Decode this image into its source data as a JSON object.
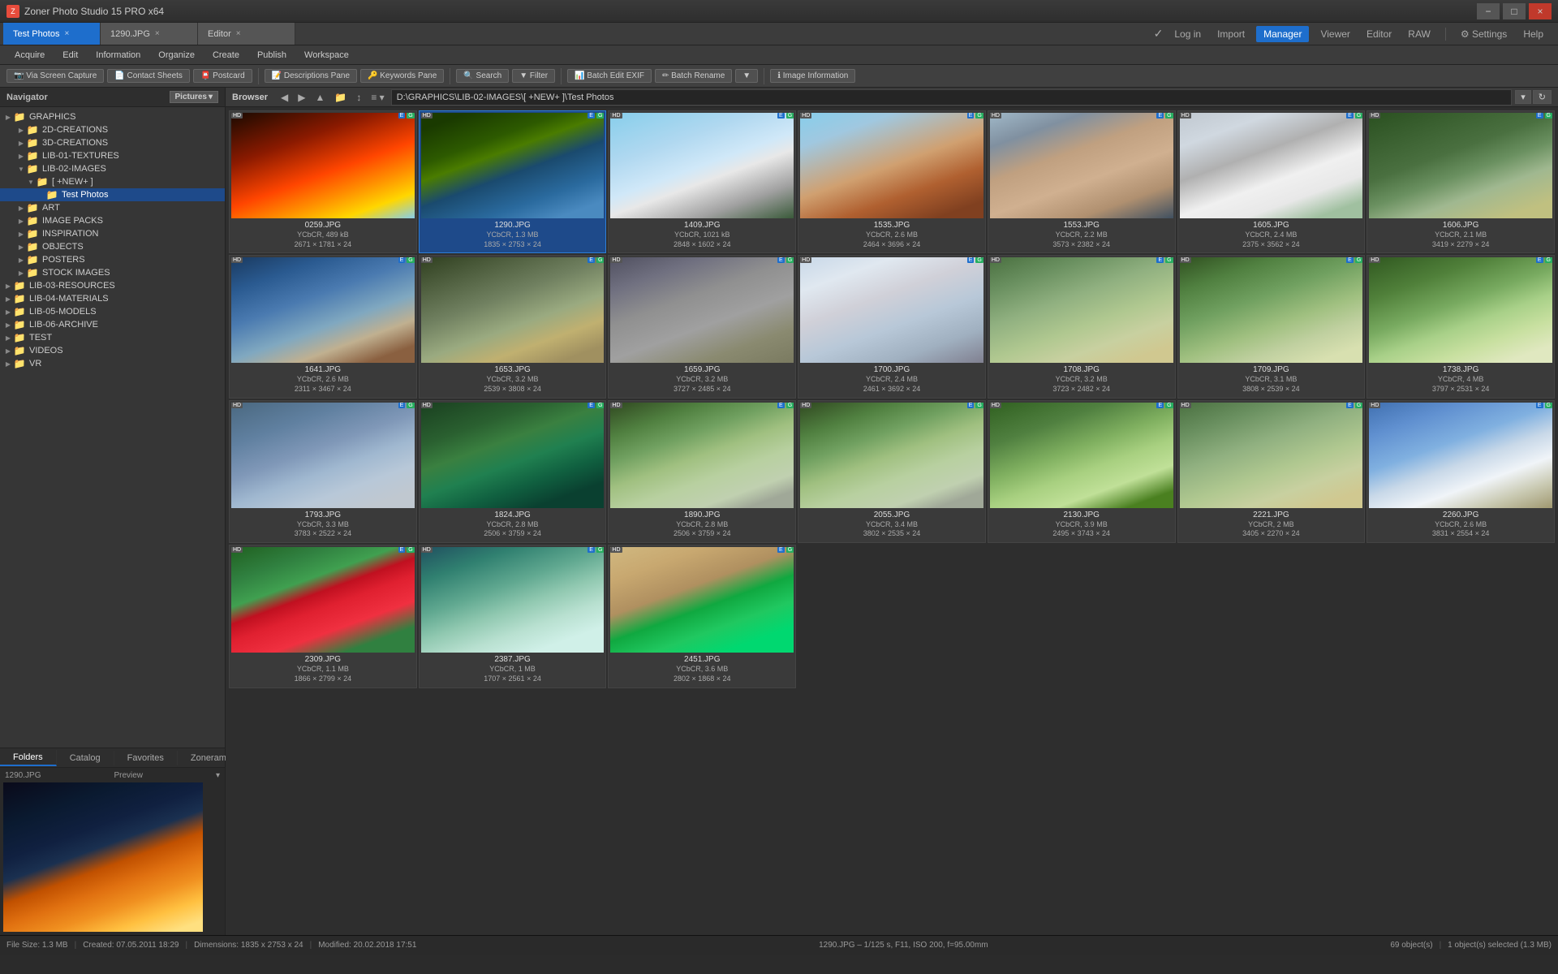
{
  "app": {
    "title": "Zoner Photo Studio 15 PRO x64",
    "icon": "Z"
  },
  "titlebar": {
    "title": "Zoner Photo Studio 15 PRO x64",
    "minimize": "−",
    "maximize": "□",
    "close": "×"
  },
  "tabs": [
    {
      "label": "Test Photos",
      "active": true
    },
    {
      "label": "1290.JPG",
      "active": false
    },
    {
      "label": "Editor",
      "active": false
    }
  ],
  "top_nav": {
    "log_in": "Log in",
    "import": "Import",
    "manager": "Manager",
    "viewer": "Viewer",
    "editor": "Editor",
    "raw": "RAW",
    "settings": "Settings",
    "help": "Help"
  },
  "menu": {
    "items": [
      "Acquire",
      "Edit",
      "Information",
      "Organize",
      "Create",
      "Publish",
      "Workspace"
    ]
  },
  "toolbar": {
    "items": [
      "Via Screen Capture",
      "Contact Sheets",
      "Postcard",
      "Descriptions Pane",
      "Keywords Pane",
      "Search",
      "Filter",
      "Batch Edit EXIF",
      "Batch Rename",
      "Image Information"
    ]
  },
  "navigator": {
    "label": "Navigator",
    "pictures": "Pictures",
    "tree": [
      {
        "indent": 0,
        "toggle": "▶",
        "label": "GRAPHICS",
        "icon": "📁",
        "level": 0
      },
      {
        "indent": 1,
        "toggle": "▶",
        "label": "2D-CREATIONS",
        "icon": "📁",
        "level": 1
      },
      {
        "indent": 1,
        "toggle": "▶",
        "label": "3D-CREATIONS",
        "icon": "📁",
        "level": 1
      },
      {
        "indent": 1,
        "toggle": "▶",
        "label": "LIB-01-TEXTURES",
        "icon": "📁",
        "level": 1
      },
      {
        "indent": 1,
        "toggle": "▼",
        "label": "LIB-02-IMAGES",
        "icon": "📁",
        "level": 1
      },
      {
        "indent": 2,
        "toggle": "▼",
        "label": "[ +NEW+ ]",
        "icon": "📁",
        "level": 2
      },
      {
        "indent": 3,
        "toggle": " ",
        "label": "Test Photos",
        "icon": "📁",
        "level": 3,
        "selected": true
      },
      {
        "indent": 1,
        "toggle": "▶",
        "label": "ART",
        "icon": "📁",
        "level": 1
      },
      {
        "indent": 1,
        "toggle": "▶",
        "label": "IMAGE PACKS",
        "icon": "📁",
        "level": 1
      },
      {
        "indent": 1,
        "toggle": "▶",
        "label": "INSPIRATION",
        "icon": "📁",
        "level": 1
      },
      {
        "indent": 1,
        "toggle": "▶",
        "label": "OBJECTS",
        "icon": "📁",
        "level": 1
      },
      {
        "indent": 1,
        "toggle": "▶",
        "label": "POSTERS",
        "icon": "📁",
        "level": 1
      },
      {
        "indent": 1,
        "toggle": "▶",
        "label": "STOCK IMAGES",
        "icon": "📁",
        "level": 1
      },
      {
        "indent": 0,
        "toggle": "▶",
        "label": "LIB-03-RESOURCES",
        "icon": "📁",
        "level": 0
      },
      {
        "indent": 0,
        "toggle": "▶",
        "label": "LIB-04-MATERIALS",
        "icon": "📁",
        "level": 0
      },
      {
        "indent": 0,
        "toggle": "▶",
        "label": "LIB-05-MODELS",
        "icon": "📁",
        "level": 0
      },
      {
        "indent": 0,
        "toggle": "▶",
        "label": "LIB-06-ARCHIVE",
        "icon": "📁",
        "level": 0
      },
      {
        "indent": 0,
        "toggle": "▶",
        "label": "TEST",
        "icon": "📁",
        "level": 0
      },
      {
        "indent": 0,
        "toggle": "▶",
        "label": "VIDEOS",
        "icon": "📁",
        "level": 0
      },
      {
        "indent": 0,
        "toggle": "▶",
        "label": "VR",
        "icon": "📁",
        "level": 0
      }
    ]
  },
  "bottom_tabs": [
    "Folders",
    "Catalog",
    "Favorites",
    "Zonerama"
  ],
  "preview": {
    "filename": "1290.JPG",
    "label": "Preview"
  },
  "statusbar": {
    "filesize": "File Size: 1.3 MB",
    "created": "Created: 07.05.2011 18:29",
    "dimensions": "Dimensions: 1835 x 2753 x 24",
    "modified": "Modified: 20.02.2018 17:51",
    "exif": "1290.JPG – 1/125 s, F11, ISO 200, f=95.00mm",
    "objects": "69 object(s)",
    "selected": "1 object(s) selected (1.3 MB)"
  },
  "browser": {
    "title": "Browser",
    "path": "D:\\GRAPHICS\\LIB-02-IMAGES\\[ +NEW+ ]\\Test Photos"
  },
  "thumbnails": [
    {
      "name": "0259.JPG",
      "info": "YCbCR, 489 kB",
      "dims": "2671 × 1781 × 24",
      "color_class": "ph-sunset",
      "selected": false
    },
    {
      "name": "1290.JPG",
      "info": "YCbCR, 1.3 MB",
      "dims": "1835 × 2753 × 24",
      "color_class": "ph-lake",
      "selected": true
    },
    {
      "name": "1409.JPG",
      "info": "YCbCR, 1021 kB",
      "dims": "2848 × 1602 × 24",
      "color_class": "ph-plane",
      "selected": false
    },
    {
      "name": "1535.JPG",
      "info": "YCbCR, 2.6 MB",
      "dims": "2464 × 3696 × 24",
      "color_class": "ph-terrace",
      "selected": false
    },
    {
      "name": "1553.JPG",
      "info": "YCbCR, 2.2 MB",
      "dims": "3573 × 2382 × 24",
      "color_class": "ph-city",
      "selected": false
    },
    {
      "name": "1605.JPG",
      "info": "YCbCR, 2.4 MB",
      "dims": "2375 × 3562 × 24",
      "color_class": "ph-mountain-snow",
      "selected": false
    },
    {
      "name": "1606.JPG",
      "info": "YCbCR, 2.1 MB",
      "dims": "3419 × 2279 × 24",
      "color_class": "ph-mountain-road",
      "selected": false
    },
    {
      "name": "1641.JPG",
      "info": "YCbCR, 2.6 MB",
      "dims": "2311 × 3467 × 24",
      "color_class": "ph-mountain-path",
      "selected": false
    },
    {
      "name": "1653.JPG",
      "info": "YCbCR, 3.2 MB",
      "dims": "2539 × 3808 × 24",
      "color_class": "ph-peru-ruins",
      "selected": false
    },
    {
      "name": "1659.JPG",
      "info": "YCbCR, 3.2 MB",
      "dims": "3727 × 2485 × 24",
      "color_class": "ph-rocky",
      "selected": false
    },
    {
      "name": "1700.JPG",
      "info": "YCbCR, 2.4 MB",
      "dims": "2461 × 3692 × 24",
      "color_class": "ph-snow-peaks",
      "selected": false
    },
    {
      "name": "1708.JPG",
      "info": "YCbCR, 3.2 MB",
      "dims": "3723 × 2482 × 24",
      "color_class": "ph-llamas",
      "selected": false
    },
    {
      "name": "1709.JPG",
      "info": "YCbCR, 3.1 MB",
      "dims": "3808 × 2539 × 24",
      "color_class": "ph-valley",
      "selected": false
    },
    {
      "name": "1738.JPG",
      "info": "YCbCR, 4 MB",
      "dims": "3797 × 2531 × 24",
      "color_class": "ph-village",
      "selected": false
    },
    {
      "name": "1793.JPG",
      "info": "YCbCR, 3.3 MB",
      "dims": "3783 × 2522 × 24",
      "color_class": "ph-crowd",
      "selected": false
    },
    {
      "name": "1824.JPG",
      "info": "YCbCR, 2.8 MB",
      "dims": "2506 × 3759 × 24",
      "color_class": "ph-tropical",
      "selected": false
    },
    {
      "name": "1890.JPG",
      "info": "YCbCR, 2.8 MB",
      "dims": "2506 × 3759 × 24",
      "color_class": "ph-machu",
      "selected": false
    },
    {
      "name": "2055.JPG",
      "info": "YCbCR, 3.4 MB",
      "dims": "3802 × 2535 × 24",
      "color_class": "ph-machu",
      "selected": false
    },
    {
      "name": "2130.JPG",
      "info": "YCbCR, 3.9 MB",
      "dims": "2495 × 3743 × 24",
      "color_class": "ph-tree-field",
      "selected": false
    },
    {
      "name": "2221.JPG",
      "info": "YCbCR, 2 MB",
      "dims": "3405 × 2270 × 24",
      "color_class": "ph-llamas",
      "selected": false
    },
    {
      "name": "2260.JPG",
      "info": "YCbCR, 2.6 MB",
      "dims": "3831 × 2554 × 24",
      "color_class": "ph-church",
      "selected": false
    },
    {
      "name": "2309.JPG",
      "info": "YCbCR, 1.1 MB",
      "dims": "1866 × 2799 × 24",
      "color_class": "ph-flower",
      "selected": false
    },
    {
      "name": "2387.JPG",
      "info": "YCbCR, 1 MB",
      "dims": "1707 × 2561 × 24",
      "color_class": "ph-waterfall",
      "selected": false
    },
    {
      "name": "2451.JPG",
      "info": "YCbCR, 3.6 MB",
      "dims": "2802 × 1868 × 24",
      "color_class": "ph-butterfly",
      "selected": false
    }
  ]
}
